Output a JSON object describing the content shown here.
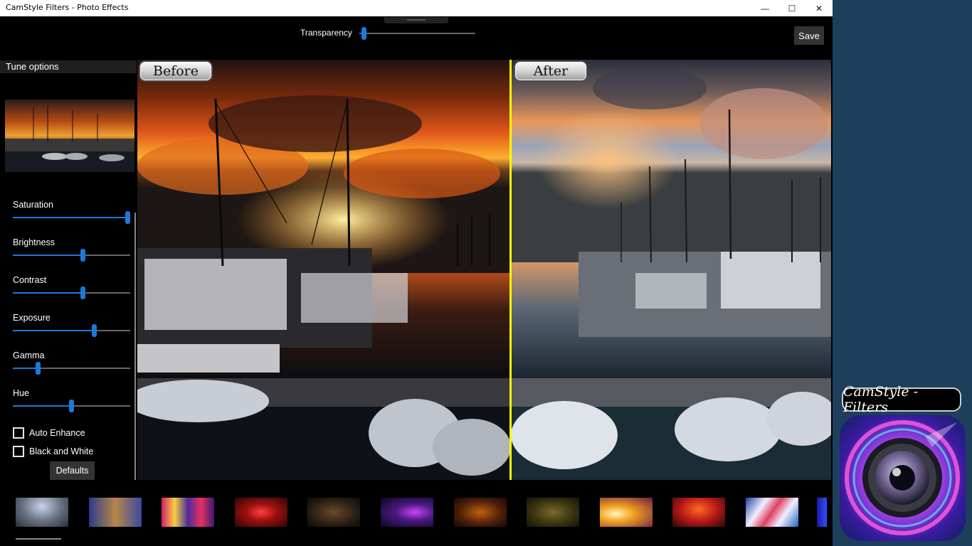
{
  "window": {
    "title": "CamStyle Filters - Photo Effects",
    "minimize_glyph": "—",
    "maximize_glyph": "☐",
    "close_glyph": "✕"
  },
  "toolbar": {
    "transparency_label": "Transparency",
    "transparency_value": 0.02,
    "save_label": "Save"
  },
  "tune": {
    "header": "Tune options",
    "sliders": [
      {
        "label": "Saturation",
        "value": 1.0
      },
      {
        "label": "Brightness",
        "value": 0.6
      },
      {
        "label": "Contrast",
        "value": 0.6
      },
      {
        "label": "Exposure",
        "value": 0.7
      },
      {
        "label": "Gamma",
        "value": 0.2
      },
      {
        "label": "Hue",
        "value": 0.5
      }
    ],
    "checkboxes": [
      {
        "label": "Auto Enhance",
        "checked": false
      },
      {
        "label": "Black and White",
        "checked": false
      }
    ],
    "defaults_label": "Defaults"
  },
  "compare": {
    "before_label": "Before",
    "after_label": "After"
  },
  "filters": {
    "count": 11
  },
  "promo": {
    "title": "CamStyle - Filters"
  },
  "colors": {
    "accent": "#1e78d8",
    "divider": "#ffff00",
    "desktop": "#1d3f5c"
  }
}
